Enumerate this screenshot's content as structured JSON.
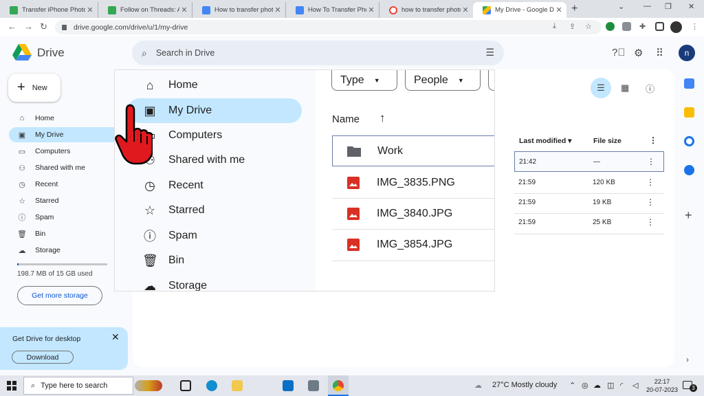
{
  "browser": {
    "tabs": [
      {
        "title": "Transfer iPhone Photo",
        "color": "#34a853"
      },
      {
        "title": "Follow on Threads: Ar",
        "color": "#34a853"
      },
      {
        "title": "How to transfer photo",
        "color": "#4285f4"
      },
      {
        "title": "How To Transfer Photo",
        "color": "#4285f4"
      },
      {
        "title": "how to transfer photo",
        "color": "#ea4335"
      },
      {
        "title": "My Drive - Google Dri",
        "color": "#fbbc04"
      }
    ],
    "new_tab": "+",
    "url": "drive.google.com/drive/u/1/my-drive"
  },
  "drive": {
    "brand": "Drive",
    "search_placeholder": "Search in Drive",
    "avatar_letter": "n",
    "new_label": "New",
    "nav": [
      {
        "label": "Home",
        "icon": "home-icon"
      },
      {
        "label": "My Drive",
        "icon": "drive-icon",
        "active": true
      },
      {
        "label": "Computers",
        "icon": "computer-icon"
      },
      {
        "label": "Shared with me",
        "icon": "people-icon"
      },
      {
        "label": "Recent",
        "icon": "clock-icon"
      },
      {
        "label": "Starred",
        "icon": "star-icon"
      },
      {
        "label": "Spam",
        "icon": "spam-icon"
      },
      {
        "label": "Bin",
        "icon": "bin-icon"
      },
      {
        "label": "Storage",
        "icon": "cloud-icon"
      }
    ],
    "storage_usage": "198.7 MB of 15 GB used",
    "storage_fraction": 0.013,
    "get_storage": "Get more storage",
    "promo_title": "Get Drive for desktop",
    "promo_button": "Download",
    "columns": {
      "last_modified": "Last modified",
      "file_size": "File size"
    },
    "rows": [
      {
        "modified": "21:42",
        "size": "—"
      },
      {
        "modified": "21:59",
        "size": "120 KB"
      },
      {
        "modified": "21:59",
        "size": "19 KB"
      },
      {
        "modified": "21:59",
        "size": "25 KB"
      }
    ]
  },
  "zoom": {
    "filters": [
      "Type",
      "People"
    ],
    "name_header": "Name",
    "files": [
      {
        "name": "Work",
        "icon": "folder-icon",
        "color": "#5f6368"
      },
      {
        "name": "IMG_3835.PNG",
        "icon": "image-icon",
        "color": "#d93025"
      },
      {
        "name": "IMG_3840.JPG",
        "icon": "image-icon",
        "color": "#d93025"
      },
      {
        "name": "IMG_3854.JPG",
        "icon": "image-icon",
        "color": "#d93025"
      }
    ]
  },
  "taskbar": {
    "search_placeholder": "Type here to search",
    "weather": "27°C  Mostly cloudy",
    "time": "22:17",
    "date": "20-07-2023",
    "notifications": "3"
  }
}
